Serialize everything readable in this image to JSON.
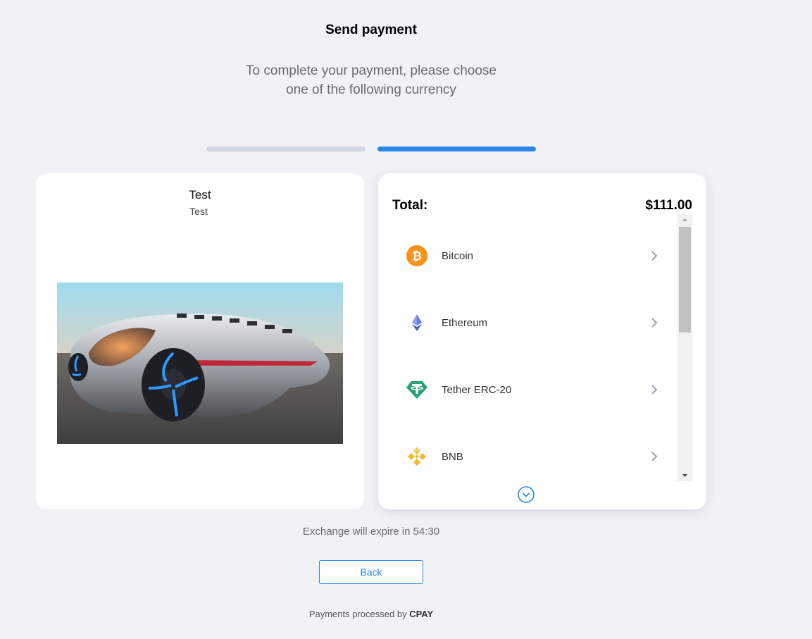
{
  "header": {
    "title": "Send payment",
    "subtitle_line1": "To complete your payment, please choose",
    "subtitle_line2": "one of the following currency"
  },
  "steps": {
    "count": 2,
    "active": 2,
    "active_color": "#2b84e6",
    "inactive_color": "#cfd7e3"
  },
  "product": {
    "name": "Test",
    "description": "Test"
  },
  "summary": {
    "total_label": "Total:",
    "total_value": "$111.00"
  },
  "currencies": [
    {
      "label": "Bitcoin",
      "icon": "bitcoin-icon",
      "color": "#f7931a"
    },
    {
      "label": "Ethereum",
      "icon": "ethereum-icon",
      "color": "#627eea"
    },
    {
      "label": "Tether ERC-20",
      "icon": "tether-icon",
      "color": "#26a17b"
    },
    {
      "label": "BNB",
      "icon": "bnb-icon",
      "color": "#f3ba2f"
    }
  ],
  "expire": {
    "text": "Exchange will expire in 54:30"
  },
  "actions": {
    "back_label": "Back"
  },
  "footer": {
    "prefix": "Payments processed by",
    "brand": "CPAY"
  }
}
